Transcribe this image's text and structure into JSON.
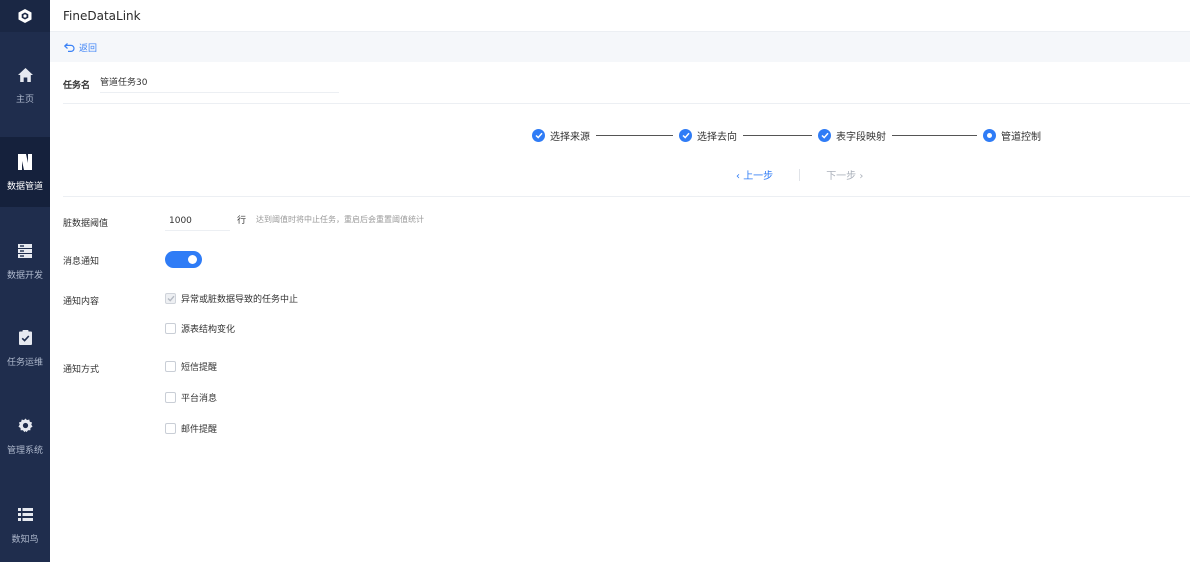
{
  "app": {
    "title": "FineDataLink"
  },
  "sidebar": {
    "items": [
      {
        "label": "主页",
        "icon": "home-icon"
      },
      {
        "label": "数据管道",
        "icon": "pipeline-icon",
        "active": true
      },
      {
        "label": "数据开发",
        "icon": "data-dev-icon"
      },
      {
        "label": "任务运维",
        "icon": "clipboard-check-icon"
      },
      {
        "label": "管理系统",
        "icon": "gear-icon"
      },
      {
        "label": "数知鸟",
        "icon": "list-icon"
      }
    ]
  },
  "back": {
    "label": "返回",
    "icon": "undo-arrow-icon"
  },
  "task": {
    "label": "任务名",
    "value": "管道任务30"
  },
  "steps": [
    {
      "label": "选择来源",
      "status": "done"
    },
    {
      "label": "选择去向",
      "status": "done"
    },
    {
      "label": "表字段映射",
      "status": "done"
    },
    {
      "label": "管道控制",
      "status": "current"
    }
  ],
  "step_nav": {
    "prev": "上一步",
    "next": "下一步",
    "prev_icon": "chevron-left-icon",
    "next_icon": "chevron-right-icon"
  },
  "form": {
    "threshold": {
      "label": "脏数据阈值",
      "value": "1000",
      "unit": "行",
      "hint": "达到阈值时将中止任务，重启后会重置阈值统计"
    },
    "notify": {
      "label": "消息通知",
      "enabled": true
    },
    "content": {
      "label": "通知内容",
      "options": [
        {
          "label": "异常或脏数据导致的任务中止",
          "checked": true,
          "disabled": true
        },
        {
          "label": "源表结构变化",
          "checked": false
        }
      ]
    },
    "method": {
      "label": "通知方式",
      "options": [
        {
          "label": "短信提醒",
          "checked": false
        },
        {
          "label": "平台消息",
          "checked": false
        },
        {
          "label": "邮件提醒",
          "checked": false
        }
      ]
    }
  },
  "colors": {
    "sidebar": "#1f2d4d",
    "accent": "#2f7cf6",
    "muted": "#999999"
  }
}
